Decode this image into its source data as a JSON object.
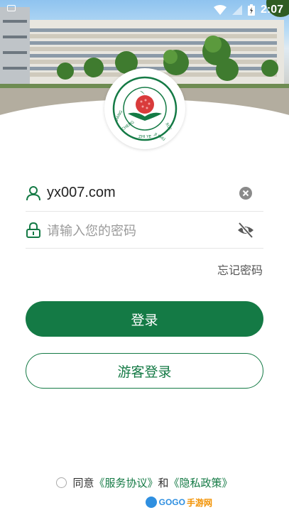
{
  "status_bar": {
    "time": "2:07",
    "icons": [
      "notification-icon",
      "wifi-icon",
      "signal-icon",
      "battery-icon"
    ]
  },
  "header": {
    "logo_ring_text": "JIANG CHENG ZHI YE JI SHU XUE XIAO"
  },
  "form": {
    "username_value": "yx007.com",
    "password_placeholder": "请输入您的密码",
    "forgot_password": "忘记密码"
  },
  "actions": {
    "login": "登录",
    "guest_login": "游客登录"
  },
  "agreement": {
    "prefix": "同意",
    "service_agreement": "《服务协议》",
    "connector": "和",
    "privacy_policy": "《隐私政策》"
  },
  "watermark": {
    "text": "GOGO",
    "text_cn": "手游网"
  },
  "colors": {
    "primary": "#147a45",
    "accent_logo_red": "#d93b3b"
  }
}
